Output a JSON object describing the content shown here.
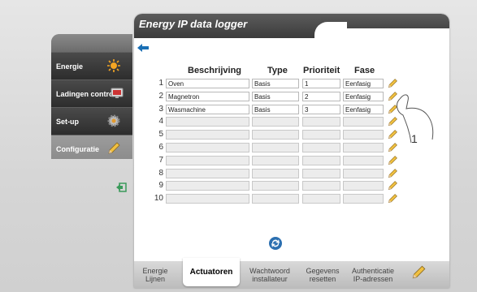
{
  "title": "Energy IP data logger",
  "sidebar": {
    "items": [
      {
        "label": "Energie",
        "icon": "sun-icon",
        "active": false
      },
      {
        "label": "Ladingen controle",
        "icon": "monitor-icon",
        "active": false
      },
      {
        "label": "Set-up",
        "icon": "gear-icon",
        "active": false
      },
      {
        "label": "Configuratie",
        "icon": "pencil-icon",
        "active": true
      }
    ]
  },
  "table": {
    "headers": {
      "description": "Beschrijving",
      "type": "Type",
      "priority": "Prioriteit",
      "phase": "Fase"
    },
    "rows": [
      {
        "num": "1",
        "description": "Oven",
        "type": "Basis",
        "priority": "1",
        "phase": "Eenfasig"
      },
      {
        "num": "2",
        "description": "Magnetron",
        "type": "Basis",
        "priority": "2",
        "phase": "Eenfasig"
      },
      {
        "num": "3",
        "description": "Wasmachine",
        "type": "Basis",
        "priority": "3",
        "phase": "Eenfasig"
      },
      {
        "num": "4",
        "description": "",
        "type": "",
        "priority": "",
        "phase": ""
      },
      {
        "num": "5",
        "description": "",
        "type": "",
        "priority": "",
        "phase": ""
      },
      {
        "num": "6",
        "description": "",
        "type": "",
        "priority": "",
        "phase": ""
      },
      {
        "num": "7",
        "description": "",
        "type": "",
        "priority": "",
        "phase": ""
      },
      {
        "num": "8",
        "description": "",
        "type": "",
        "priority": "",
        "phase": ""
      },
      {
        "num": "9",
        "description": "",
        "type": "",
        "priority": "",
        "phase": ""
      },
      {
        "num": "10",
        "description": "",
        "type": "",
        "priority": "",
        "phase": ""
      }
    ]
  },
  "callout": "1",
  "tabs": [
    {
      "label": "Energie\nLijnen",
      "active": false
    },
    {
      "label": "Actuatoren",
      "active": true
    },
    {
      "label": "Wachtwoord\ninstallateur",
      "active": false
    },
    {
      "label": "Gegevens\nresetten",
      "active": false
    },
    {
      "label": "Authenticatie\nIP-adressen",
      "active": false
    }
  ],
  "colors": {
    "accent": "#1a6fb5",
    "sidebar_dark": "#333333",
    "title_bar": "#4a4a4a"
  }
}
